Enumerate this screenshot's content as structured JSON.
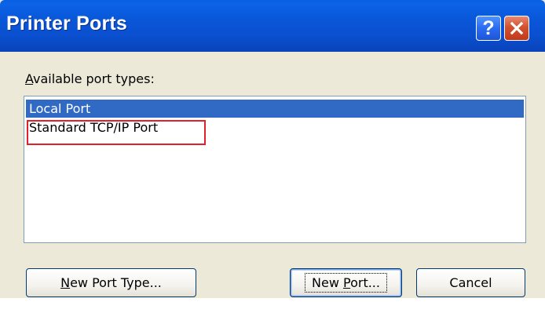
{
  "window": {
    "title": "Printer Ports"
  },
  "titlebar_buttons": {
    "help_icon": "help-question-icon",
    "help_label": "?",
    "close_icon": "close-x-icon"
  },
  "port_types": {
    "label_mnemonic": "A",
    "label_rest": "vailable port types:",
    "items": [
      {
        "label": "Local Port",
        "selected": true
      },
      {
        "label": "Standard TCP/IP Port",
        "selected": false,
        "highlighted": true
      }
    ]
  },
  "buttons": {
    "new_port_type": {
      "mnemonic": "N",
      "rest": "ew Port Type..."
    },
    "new_port": {
      "pre": "New ",
      "mnemonic": "P",
      "rest": "ort..."
    },
    "cancel": {
      "label": "Cancel"
    }
  },
  "colors": {
    "titlebar": "#0a56d8",
    "selection": "#316ac5",
    "annotation": "#e0202a",
    "close_button": "#d3512f",
    "dialog_background": "#ece9d8"
  }
}
